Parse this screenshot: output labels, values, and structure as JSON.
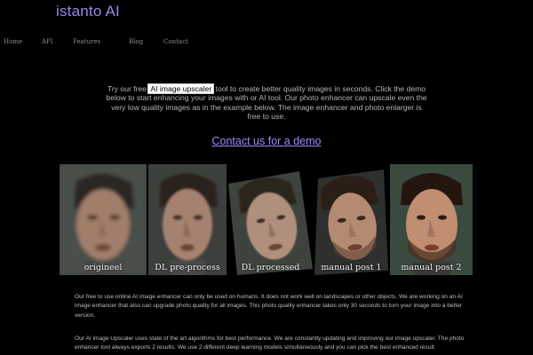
{
  "brand": {
    "name": "istanto AI"
  },
  "nav": {
    "items": [
      {
        "label": "Home"
      },
      {
        "label": "API"
      },
      {
        "label": "Features"
      },
      {
        "label": "Blog"
      },
      {
        "label": "Contact"
      }
    ]
  },
  "intro": {
    "before": "Try our free ",
    "highlight": "AI image upscaler",
    "after": " tool to create better quality images in seconds. Click the demo below to start enhancing your images with or AI tool. Our photo enhancer can upscale even the very low quality images as in the example below. The image enhancer and photo enlarger is free to use."
  },
  "cta": {
    "label": "Contact us for a demo"
  },
  "gallery": {
    "items": [
      {
        "caption": "origineel"
      },
      {
        "caption": "DL pre-process"
      },
      {
        "caption": "DL processed"
      },
      {
        "caption": "manual post 1"
      },
      {
        "caption": "manual post 2"
      }
    ]
  },
  "body": {
    "paragraph_1": "Our free to use online AI image enhancer can only be used on humans. It does not work well on landscapes or other objects. We are working on an AI image enhancer that also can upgrade photo quality for all images. This photo quality enhancer takes only 30 seconds to turn your image into a better version.",
    "paragraph_2": "Our AI image Upscaler uses state of the art algorithms for best performance. We are constantly updating and improving our image upscaler. The photo enhancer tool always exports 2 results. We use 2 different deep learning models simultaneously and you can pick the best enhanced result."
  }
}
